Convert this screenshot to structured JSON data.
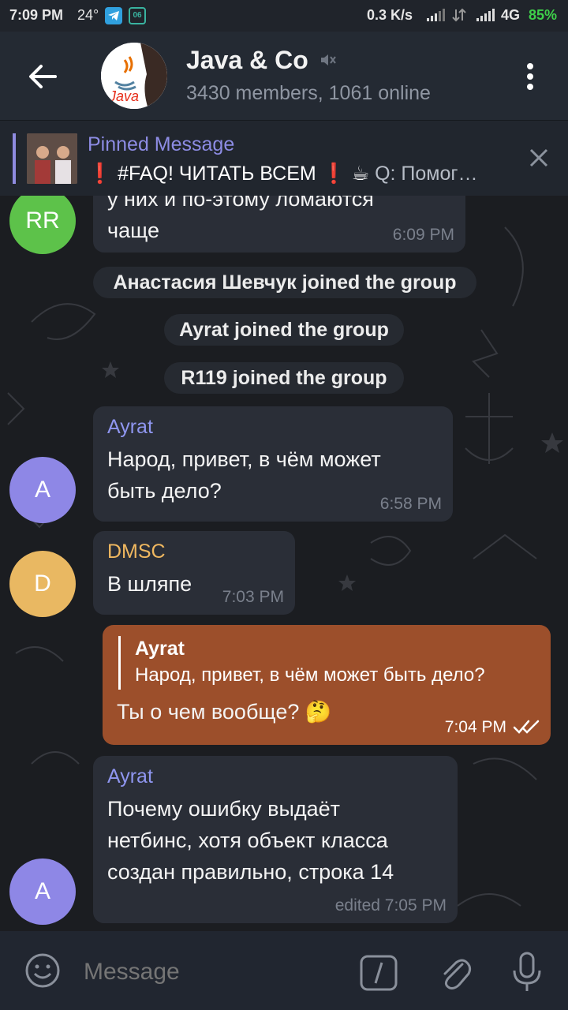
{
  "status_bar": {
    "time": "7:09 PM",
    "temperature": "24°",
    "app_badge": "06",
    "speed": "0.3 K/s",
    "network": "4G",
    "battery": "85%"
  },
  "header": {
    "title": "Java & Co",
    "subtitle": "3430 members, 1061 online",
    "avatar_text": "Java"
  },
  "pinned": {
    "title": "Pinned Message",
    "text_prefix": "❗ #FAQ! ЧИТАТЬ ВСЕМ ❗ ☕",
    "text_rest": " Q: Помог…"
  },
  "messages": {
    "m0": {
      "avatar": "RR",
      "line1": "у них и по-этому ломаются",
      "line2": "чаще",
      "time": "6:09 PM"
    },
    "service1": "Анастасия Шевчук joined the group",
    "service2": "Ayrat joined the group",
    "service3": "R119 joined the group",
    "m1": {
      "avatar": "A",
      "sender": "Ayrat",
      "line1": "Народ, привет, в чём может",
      "line2": "быть дело?",
      "time": "6:58 PM"
    },
    "m2": {
      "avatar": "D",
      "sender": "DMSC",
      "text": "В шляпе",
      "time": "7:03 PM"
    },
    "m3": {
      "reply_sender": "Ayrat",
      "reply_text": "Народ, привет, в чём может быть дело?",
      "text": "Ты о чем вообще? 🤔",
      "time": "7:04 PM"
    },
    "m4": {
      "avatar": "A",
      "sender": "Ayrat",
      "line1": "Почему ошибку выдаёт",
      "line2": "нетбинс, хотя объект класса",
      "line3": "создан правильно, строка 14",
      "time": "edited 7:05 PM"
    }
  },
  "input": {
    "placeholder": "Message"
  },
  "colors": {
    "accent_sender_blue": "#8f96f0",
    "accent_sender_dmsc": "#f0b860",
    "outgoing_bubble": "#9c4f2b",
    "avatar_rr": "#5dc24a",
    "avatar_a": "#8e87e6",
    "avatar_d": "#e9b862"
  }
}
